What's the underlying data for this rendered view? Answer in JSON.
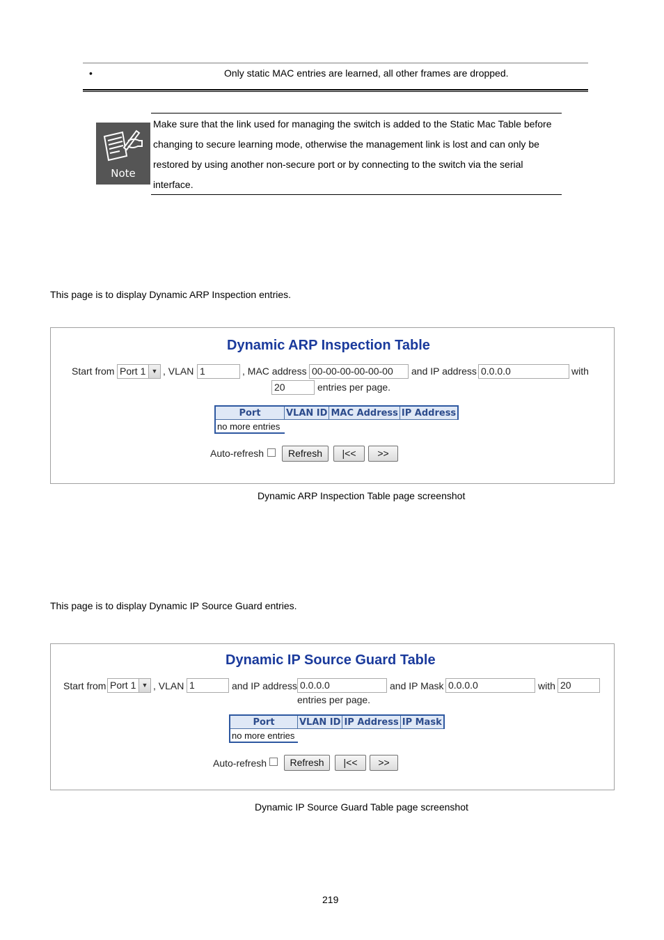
{
  "top_table": {
    "bullet": "•",
    "text": "Only static MAC entries are learned, all other frames are dropped."
  },
  "note": {
    "icon_label": "Note",
    "lines": [
      "Make sure that the link used for managing the switch is added to the Static Mac Table before",
      "changing to secure learning mode, otherwise the management link is lost and can only be",
      "restored by using another non-secure port or by connecting to the switch via the serial",
      "interface."
    ]
  },
  "arp_section": {
    "intro": "This page is to display Dynamic ARP Inspection entries.",
    "panel": {
      "title": "Dynamic ARP Inspection Table",
      "start_from_label": "Start from",
      "port_select_value": "Port 1",
      "vlan_label": ", VLAN",
      "vlan_value": "1",
      "mac_label": ", MAC address",
      "mac_value": "00-00-00-00-00-00",
      "ip_label": "and IP address",
      "ip_value": "0.0.0.0",
      "with_label": "with",
      "entries_value": "20",
      "entries_label": "entries per page.",
      "table": {
        "headers": [
          "Port",
          "VLAN ID",
          "MAC Address",
          "IP Address"
        ],
        "empty_text": "no more entries"
      },
      "auto_refresh_label": "Auto-refresh",
      "auto_refresh_checked": false,
      "buttons": {
        "refresh": "Refresh",
        "first": "|<<",
        "next": ">>"
      }
    },
    "caption": "Dynamic ARP Inspection Table page screenshot"
  },
  "ipsg_section": {
    "intro": "This page is to display Dynamic IP Source Guard entries.",
    "panel": {
      "title": "Dynamic IP Source Guard Table",
      "start_from_label": "Start from",
      "port_select_value": "Port 1",
      "vlan_label": ", VLAN",
      "vlan_value": "1",
      "ip_label": "and IP address",
      "ip_value": "0.0.0.0",
      "mask_label": "and IP Mask",
      "mask_value": "0.0.0.0",
      "with_label": "with",
      "entries_value": "20",
      "entries_label": "entries per page.",
      "table": {
        "headers": [
          "Port",
          "VLAN ID",
          "IP Address",
          "IP Mask"
        ],
        "empty_text": "no more entries"
      },
      "auto_refresh_label": "Auto-refresh",
      "auto_refresh_checked": false,
      "buttons": {
        "refresh": "Refresh",
        "first": "|<<",
        "next": ">>"
      }
    },
    "caption": "Dynamic IP Source Guard Table page screenshot"
  },
  "page_number": "219"
}
